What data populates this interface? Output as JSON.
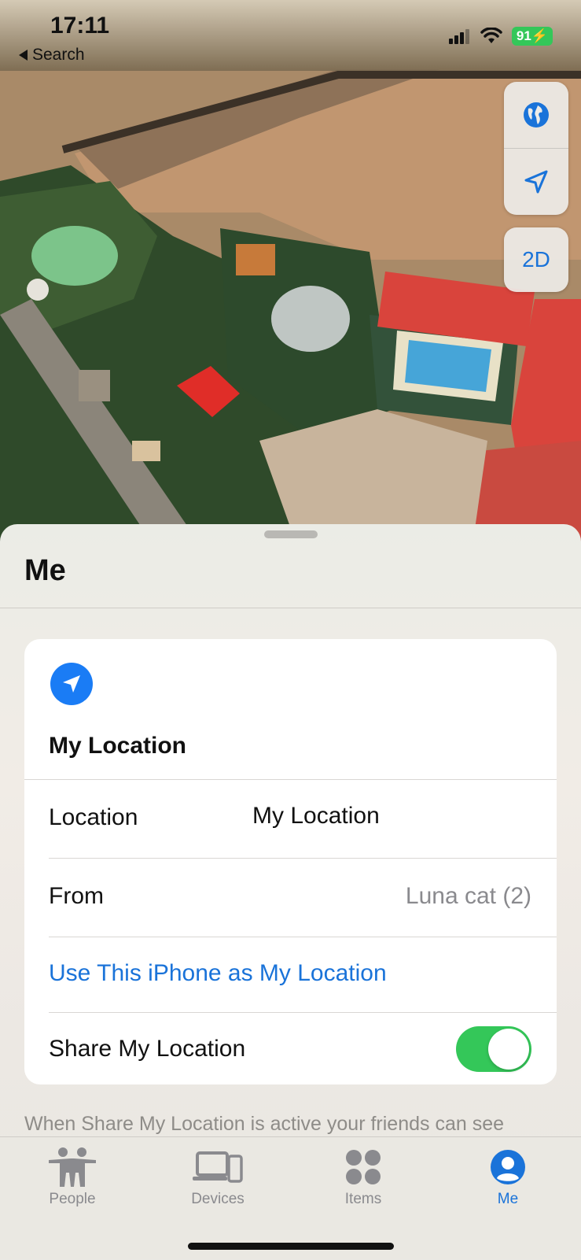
{
  "status": {
    "time": "17:11",
    "back_label": "Search",
    "battery": "91"
  },
  "map": {
    "controls": [
      {
        "icon": "globe-icon"
      },
      {
        "icon": "location-arrow-icon"
      }
    ],
    "view_mode_label": "2D"
  },
  "sheet": {
    "title": "Me",
    "card": {
      "icon": "location-arrow-icon",
      "title": "My Location",
      "rows": [
        {
          "label": "Location",
          "value": "My Location"
        },
        {
          "label": "From",
          "value": "Luna cat (2)"
        }
      ],
      "action_link": "Use This iPhone as My Location",
      "share": {
        "label": "Share My Location",
        "enabled": true
      }
    },
    "footnote": "When Share My Location is active your friends can see"
  },
  "tabbar": {
    "tabs": [
      {
        "label": "People",
        "icon": "people-icon",
        "active": false
      },
      {
        "label": "Devices",
        "icon": "devices-icon",
        "active": false
      },
      {
        "label": "Items",
        "icon": "items-icon",
        "active": false
      },
      {
        "label": "Me",
        "icon": "me-icon",
        "active": true
      }
    ]
  },
  "colors": {
    "accent": "#1a73d9",
    "toggle_on": "#34c759",
    "battery": "#34c759"
  }
}
